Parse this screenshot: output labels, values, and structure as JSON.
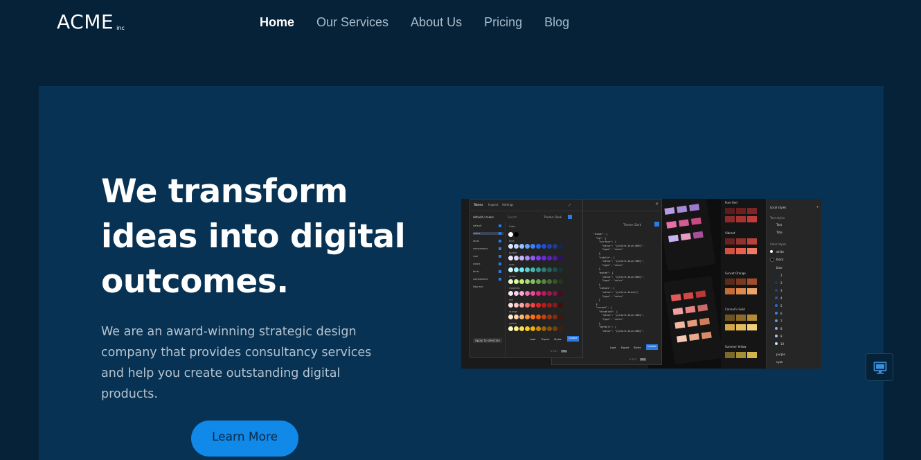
{
  "brand": {
    "name": "ACME",
    "suffix": "inc"
  },
  "nav": {
    "items": [
      {
        "label": "Home",
        "active": true
      },
      {
        "label": "Our Services",
        "active": false
      },
      {
        "label": "About Us",
        "active": false
      },
      {
        "label": "Pricing",
        "active": false
      },
      {
        "label": "Blog",
        "active": false
      }
    ]
  },
  "hero": {
    "headline": "We transform ideas into digital outcomes.",
    "subtext": "We are an award-winning strategic design company that provides consultancy services and help you create outstanding digital products.",
    "cta_label": "Learn More"
  },
  "screenshot": {
    "tabs": [
      "Tokens",
      "Inspect",
      "Settings"
    ],
    "set_selector": "default / colors",
    "search_placeholder": "Search",
    "theme_label": "Theme: Dark",
    "sets": [
      "default",
      "colors",
      "fonts",
      "components",
      "user",
      "colors",
      "fonts",
      "components",
      "New set"
    ],
    "color_group": "Color",
    "color_rows": [
      "blue",
      "purple",
      "cyan",
      "green",
      "magenta",
      "red",
      "orange",
      "yellow"
    ],
    "apply_label": "Apply to selection",
    "footer_buttons": [
      "Load",
      "Export",
      "Styles"
    ],
    "update_label": "Update",
    "version": "V 127",
    "pro_badge": "PRO",
    "local_styles_title": "Local styles",
    "text_styles_title": "Text styles",
    "text_styles": [
      "Text",
      "Title"
    ],
    "color_styles_title": "Color styles",
    "color_styles": [
      "white",
      "black",
      "blue",
      "1",
      "2",
      "3",
      "4",
      "5",
      "6",
      "7",
      "8",
      "9",
      "10",
      "purple",
      "cyan"
    ],
    "card_titles": [
      "Pure Red",
      "Vibrant",
      "Sunset Orange",
      "Cannoli's Gold",
      "Summer Yellow"
    ],
    "json_lines": [
      "  \"theme\": {",
      "    \"bg\": {",
      "      \"surface\": {",
      "        \"value\": \"{colors.blue.800}\",",
      "        \"type\": \"color\"",
      "      },",
      "      \"subtle\": {",
      "        \"value\": \"{colors.blue.900}\",",
      "        \"type\": \"color\"",
      "      },",
      "      \"muted\": {",
      "        \"value\": \"{colors.blue.600}\",",
      "        \"type\": \"color\"",
      "      },",
      "      \"canvas\": {",
      "        \"value\": \"{colors.black}\",",
      "        \"type\": \"color\"",
      "      }",
      "    },",
      "    \"accent\": {",
      "      \"disabled\": {",
      "        \"value\": \"{colors.blue.400}\",",
      "        \"type\": \"color\"",
      "      },",
      "      \"default\": {",
      "        \"value\": \"{colors.blue.600}\",",
      "        \"type\": \"color\""
    ]
  },
  "colors": {
    "page_bg": "#062238",
    "hero_bg": "#073253",
    "accent": "#1189e8"
  }
}
